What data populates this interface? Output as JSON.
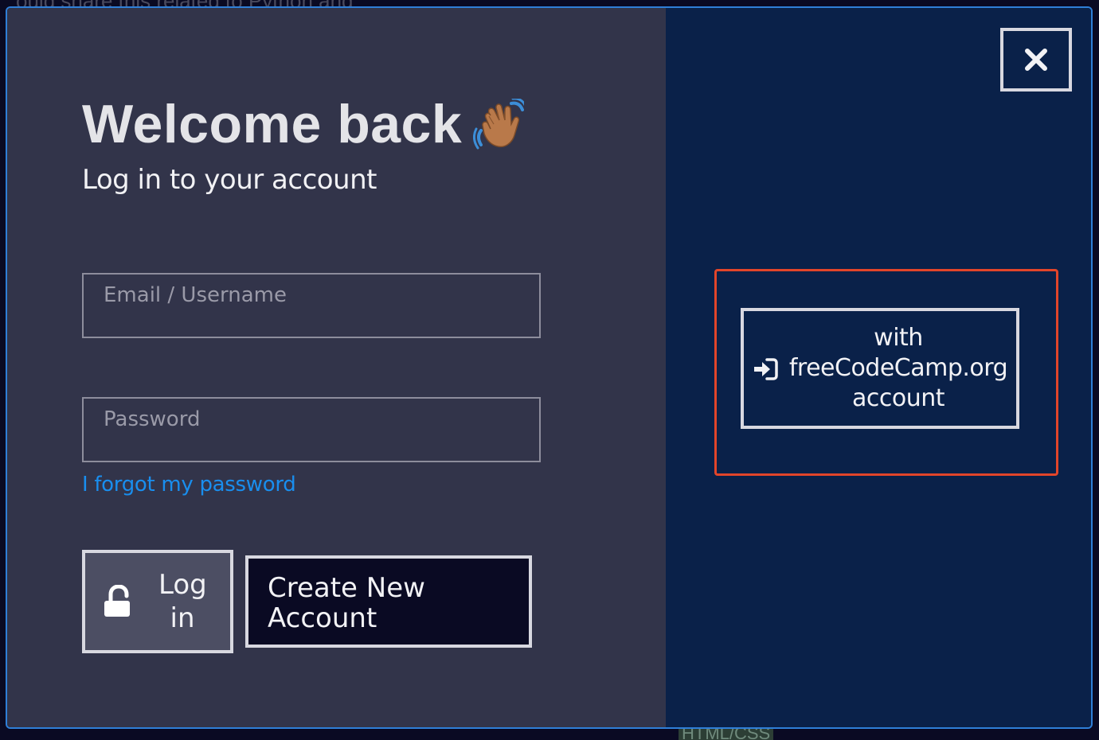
{
  "background": {
    "top_text": "ould share this related to Python and",
    "bottom_text": "HTML/CSS"
  },
  "login_panel": {
    "title": "Welcome back",
    "title_emoji": "waving-hand-icon",
    "subtitle": "Log in to your account",
    "email_placeholder": "Email / Username",
    "email_value": "",
    "password_placeholder": "Password",
    "password_value": "",
    "forgot_link": "I forgot my password",
    "login_button": {
      "icon": "unlock-icon",
      "label_line1": "Log",
      "label_line2": "in"
    },
    "create_account_button": {
      "label_line1": "Create New",
      "label_line2": "Account"
    }
  },
  "side_panel": {
    "close_icon": "close-icon",
    "oauth_button": {
      "icon": "sign-in-icon",
      "label_line1": "with",
      "label_line2": "freeCodeCamp.org",
      "label_line3": "account"
    }
  },
  "colors": {
    "left_panel_bg": "#32344a",
    "right_panel_bg": "#0a2149",
    "link": "#198eee",
    "highlight_border": "#e2452a",
    "modal_border": "#2f7fd8"
  }
}
